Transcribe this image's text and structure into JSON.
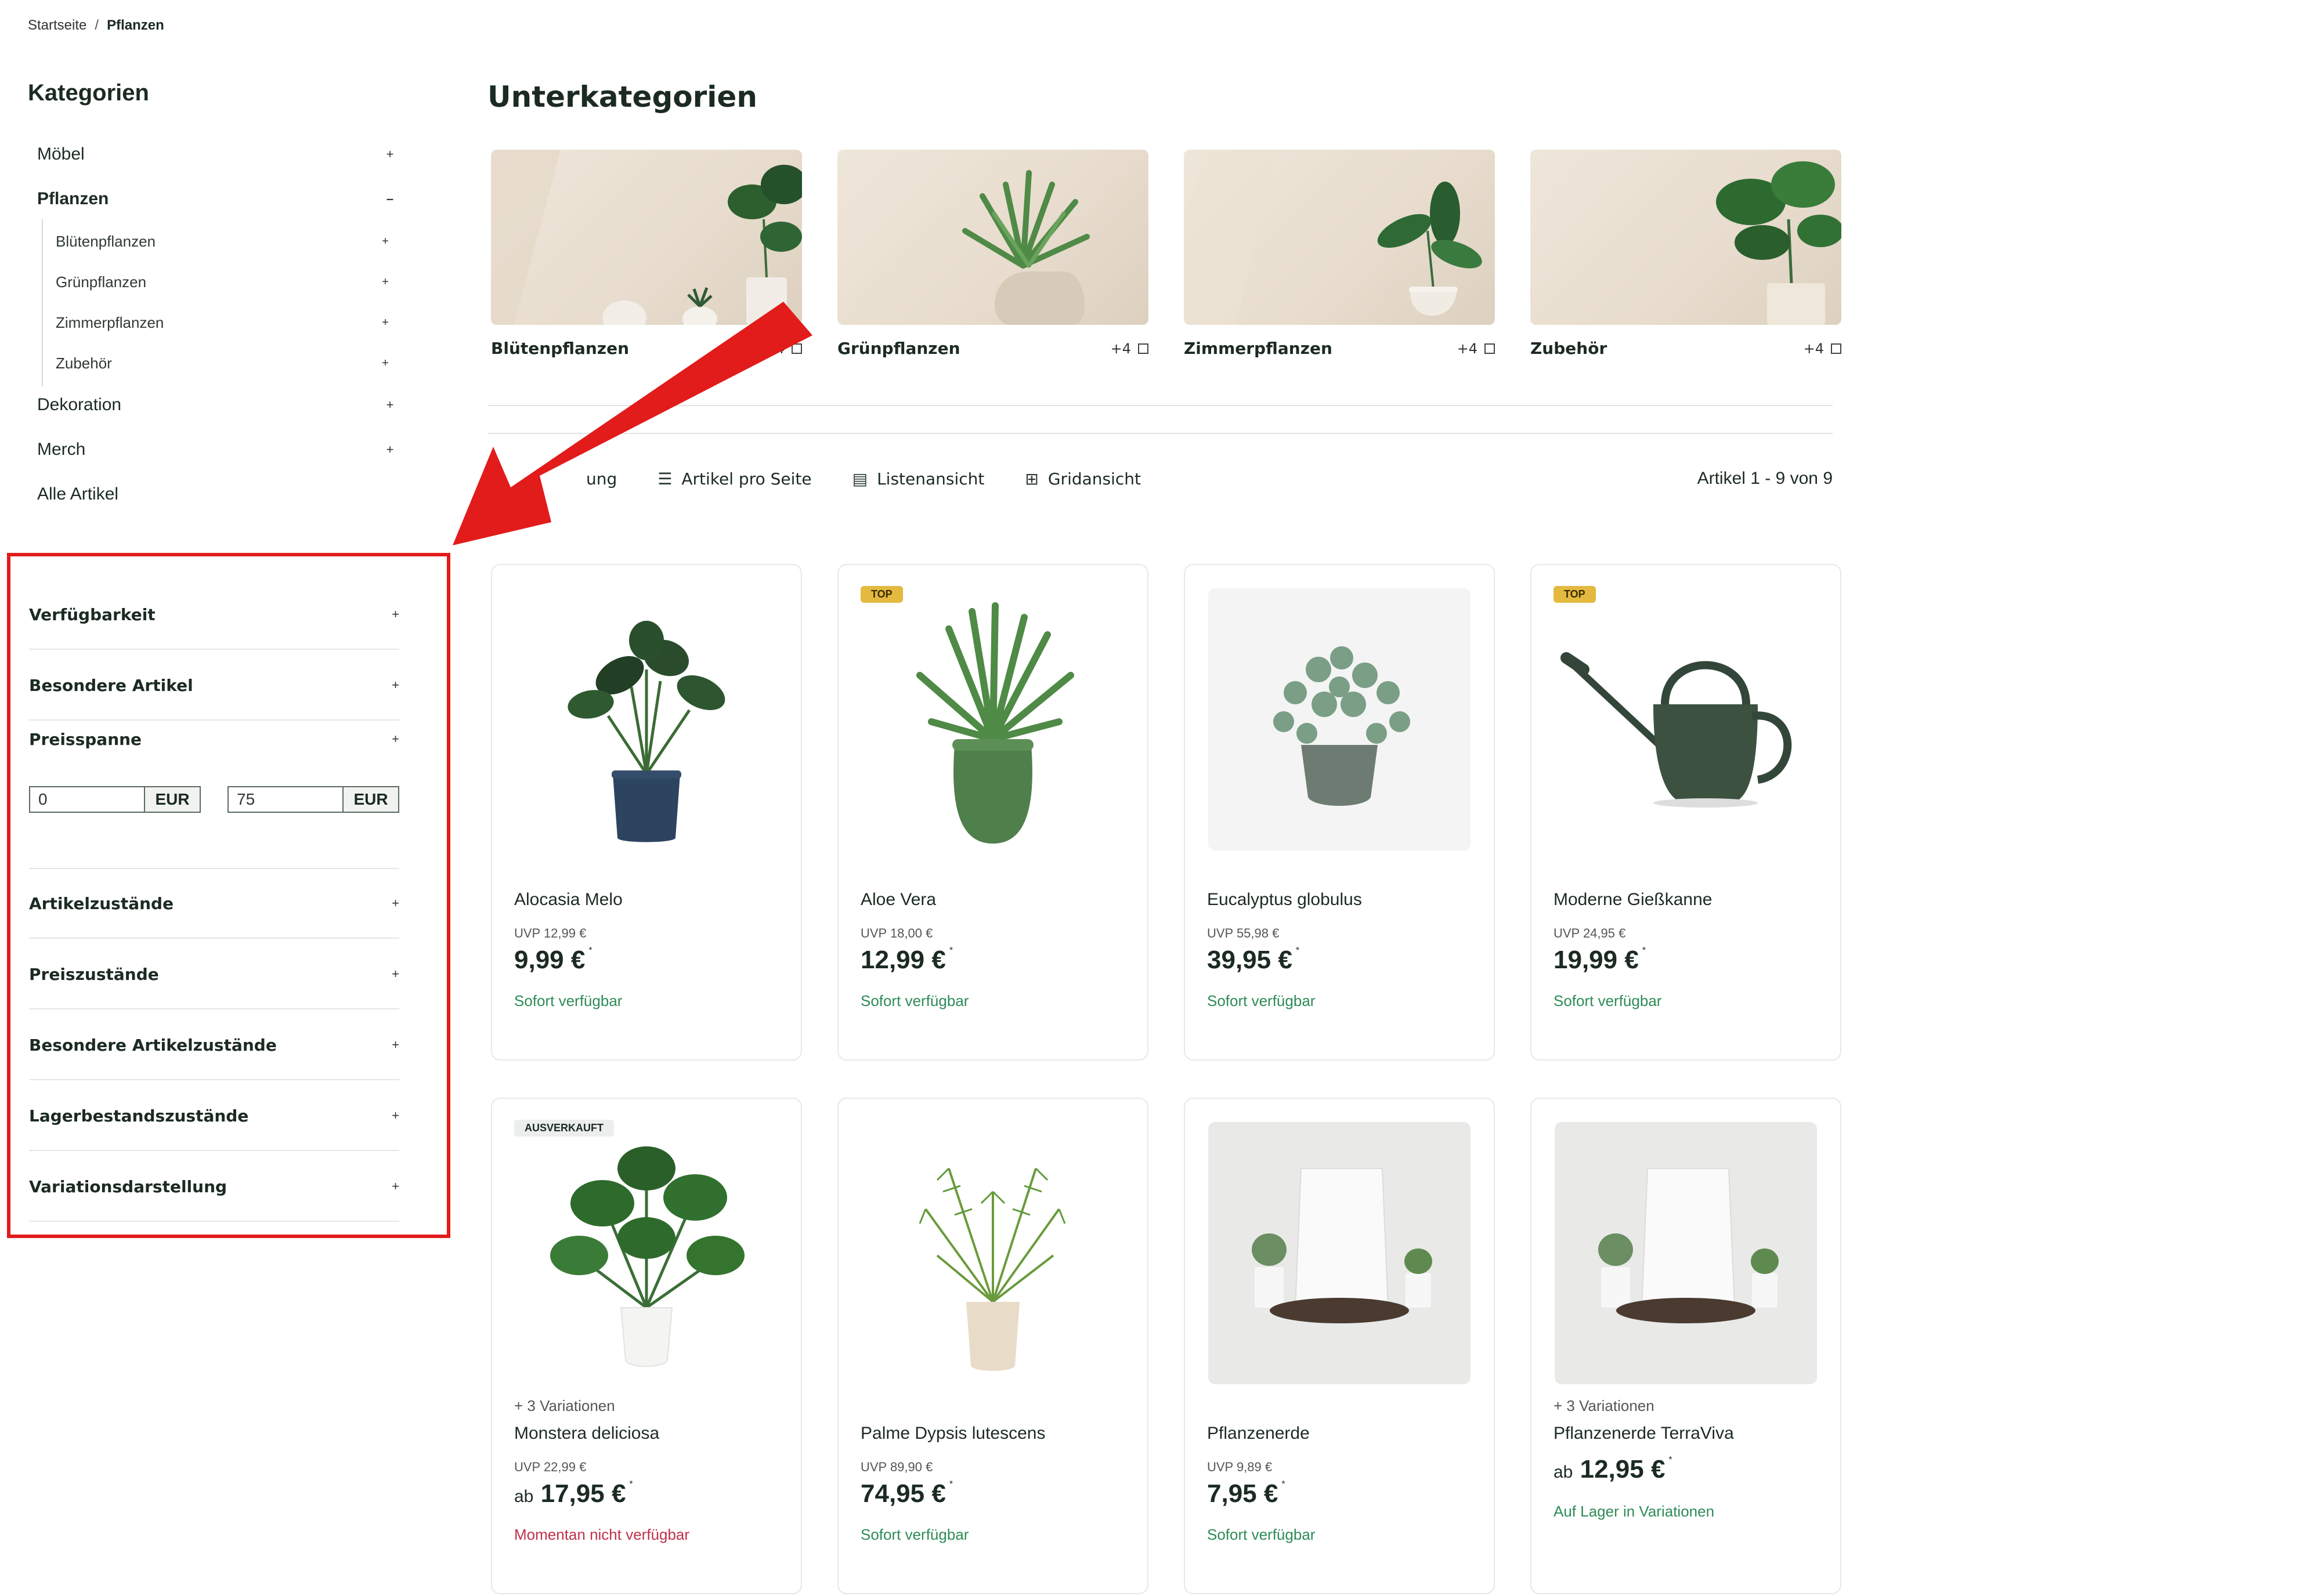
{
  "breadcrumb": {
    "home": "Startseite",
    "separator": "/",
    "current": "Pflanzen"
  },
  "sidebar": {
    "title": "Kategorien",
    "categories": [
      {
        "label": "Möbel",
        "toggle": "+"
      },
      {
        "label": "Pflanzen",
        "toggle": "–"
      },
      {
        "label": "Dekoration",
        "toggle": "+"
      },
      {
        "label": "Merch",
        "toggle": "+"
      },
      {
        "label": "Alle Artikel",
        "toggle": ""
      }
    ],
    "subcategories": [
      {
        "label": "Blütenpflanzen",
        "toggle": "+"
      },
      {
        "label": "Grünpflanzen",
        "toggle": "+"
      },
      {
        "label": "Zimmerpflanzen",
        "toggle": "+"
      },
      {
        "label": "Zubehör",
        "toggle": "+"
      }
    ]
  },
  "filters": {
    "highlight_color": "#e21b1b",
    "items": [
      {
        "label": "Verfügbarkeit",
        "toggle": "+"
      },
      {
        "label": "Besondere Artikel",
        "toggle": "+"
      },
      {
        "label": "Preisspanne",
        "toggle": "+"
      },
      {
        "label": "Artikelzustände",
        "toggle": "+"
      },
      {
        "label": "Preiszustände",
        "toggle": "+"
      },
      {
        "label": "Besondere Artikelzustände",
        "toggle": "+"
      },
      {
        "label": "Lagerbestandszustände",
        "toggle": "+"
      },
      {
        "label": "Variationsdarstellung",
        "toggle": "+"
      }
    ],
    "price_range": {
      "min_value": "0",
      "max_value": "75",
      "currency": "EUR"
    }
  },
  "main": {
    "title": "Unterkategorien",
    "subcategories": [
      {
        "label": "Blütenpflanzen",
        "more": "+4"
      },
      {
        "label": "Grünpflanzen",
        "more": "+4"
      },
      {
        "label": "Zimmerpflanzen",
        "more": "+4"
      },
      {
        "label": "Zubehör",
        "more": "+4"
      }
    ],
    "toolbar": {
      "sort_label": "ung",
      "per_page_label": "Artikel pro Seite",
      "list_view_label": "Listenansicht",
      "grid_view_label": "Gridansicht",
      "count_label": "Artikel 1 - 9 von 9"
    },
    "products": [
      {
        "name": "Alocasia Melo",
        "uvp": "UVP 12,99 €",
        "price": "9,99 €",
        "prefix": "",
        "stock": "Sofort verfügbar",
        "stock_ok": true,
        "badge": "",
        "variations": ""
      },
      {
        "name": "Aloe Vera",
        "uvp": "UVP 18,00 €",
        "price": "12,99 €",
        "prefix": "",
        "stock": "Sofort verfügbar",
        "stock_ok": true,
        "badge": "TOP",
        "variations": ""
      },
      {
        "name": "Eucalyptus globulus",
        "uvp": "UVP 55,98 €",
        "price": "39,95 €",
        "prefix": "",
        "stock": "Sofort verfügbar",
        "stock_ok": true,
        "badge": "",
        "variations": ""
      },
      {
        "name": "Moderne Gießkanne",
        "uvp": "UVP 24,95 €",
        "price": "19,99 €",
        "prefix": "",
        "stock": "Sofort verfügbar",
        "stock_ok": true,
        "badge": "TOP",
        "variations": ""
      },
      {
        "name": "Monstera deliciosa",
        "uvp": "UVP 22,99 €",
        "price": "17,95 €",
        "prefix": "ab",
        "stock": "Momentan nicht verfügbar",
        "stock_ok": false,
        "badge": "AUSVERKAUFT",
        "variations": "+ 3 Variationen"
      },
      {
        "name": "Palme Dypsis lutescens",
        "uvp": "UVP 89,90 €",
        "price": "74,95 €",
        "prefix": "",
        "stock": "Sofort verfügbar",
        "stock_ok": true,
        "badge": "",
        "variations": ""
      },
      {
        "name": "Pflanzenerde",
        "uvp": "UVP 9,89 €",
        "price": "7,95 €",
        "prefix": "",
        "stock": "Sofort verfügbar",
        "stock_ok": true,
        "badge": "",
        "variations": ""
      },
      {
        "name": "Pflanzenerde TerraViva",
        "uvp": "",
        "price": "12,95 €",
        "prefix": "ab",
        "stock": "Auf Lager in Variationen",
        "stock_ok": true,
        "badge": "",
        "variations": "+ 3 Variationen"
      }
    ],
    "price_footnote": "*"
  },
  "colors": {
    "accent_green": "#2e8b57",
    "unavailable_red": "#c0304a",
    "badge_top": "#e3b940",
    "annotation_red": "#e21b1b"
  }
}
